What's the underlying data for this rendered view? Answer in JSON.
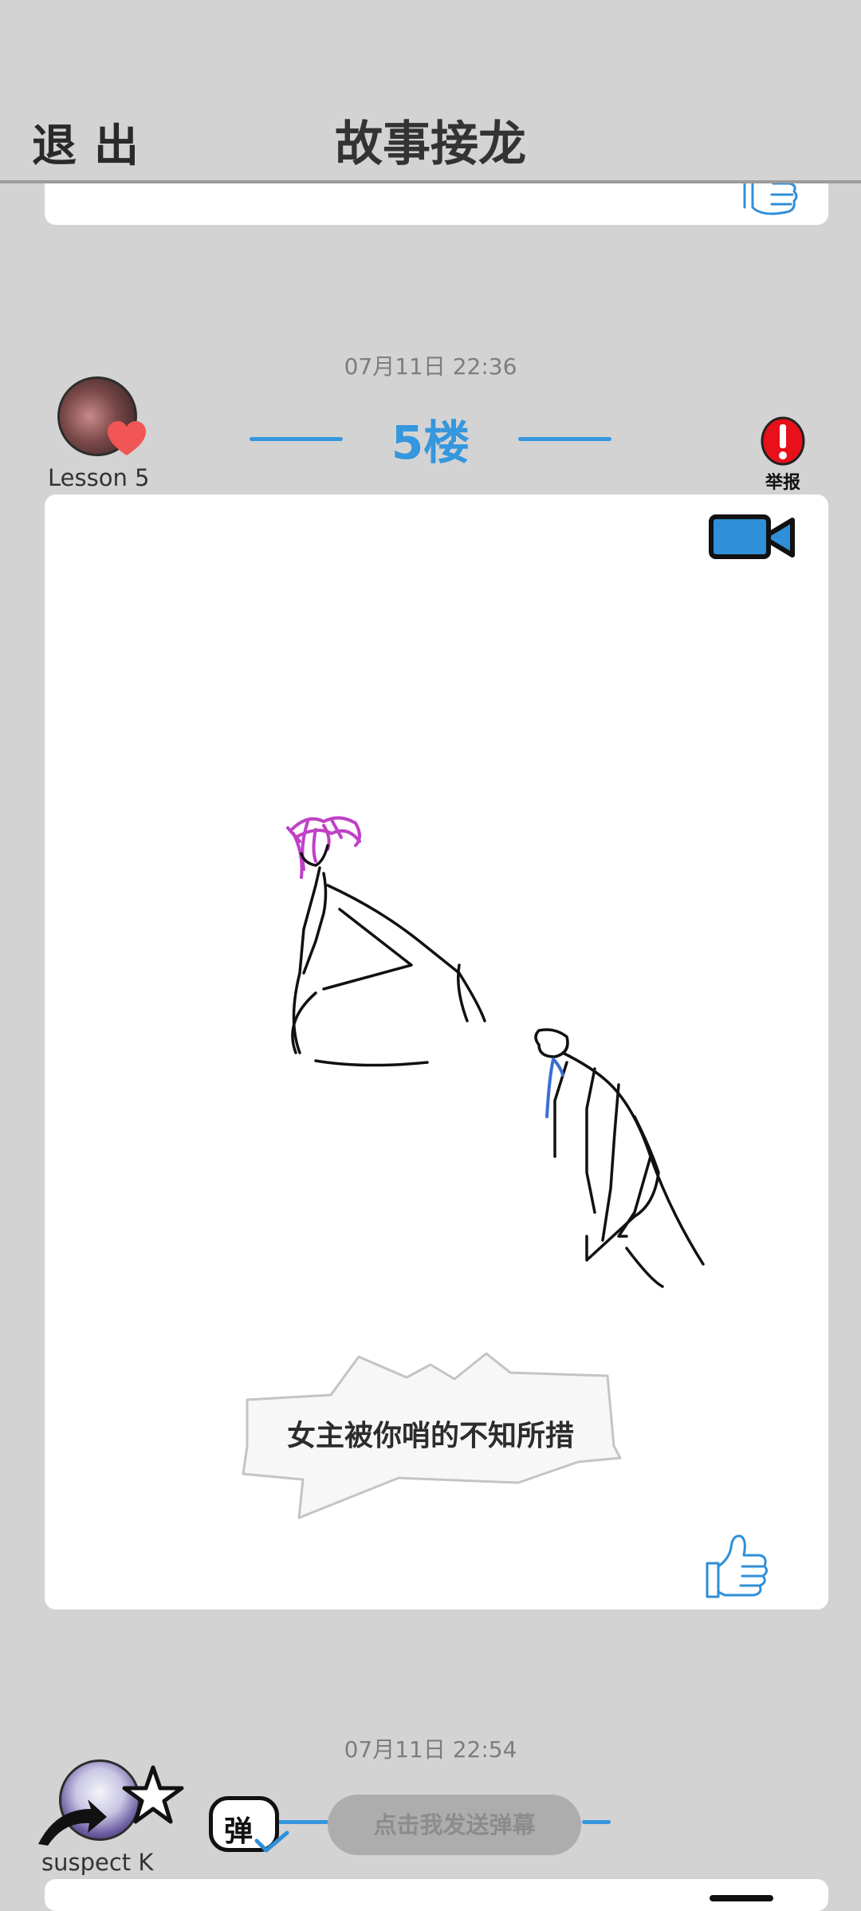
{
  "header": {
    "exit_label": "退出",
    "title": "故事接龙"
  },
  "posts": [
    {
      "timestamp": "07月11日  22:36",
      "floor_label": "5楼",
      "author": "Lesson 5",
      "report_label": "举报",
      "caption": "女主被你哨的不知所措"
    },
    {
      "timestamp": "07月11日  22:54",
      "author": "suspect K"
    }
  ],
  "danmaku": {
    "stamp_glyph": "弹",
    "send_label": "点击我发送弹幕"
  },
  "colors": {
    "accent": "#3597dd",
    "background": "#d3d3d3",
    "heart": "#f25555",
    "report": "#e8101a",
    "drawing_pink": "#c040c8",
    "drawing_blue": "#3b6fd6"
  },
  "icons": [
    "thumbs-up-icon",
    "video-camera-icon",
    "alert-icon",
    "heart-icon",
    "star-icon",
    "arrow-icon",
    "checkmark-icon"
  ]
}
